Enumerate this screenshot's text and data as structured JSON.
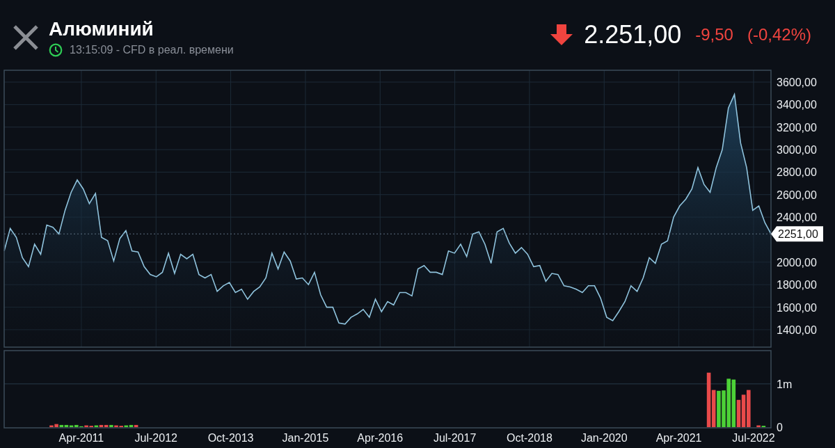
{
  "header": {
    "title": "Алюминий",
    "subtitle": "13:15:09 - CFD в реал. времени",
    "falling": true,
    "price": "2.251,00",
    "change": "-9,50",
    "change_percent": "(-0,42%)"
  },
  "price_chart": {
    "chart_data": {
      "type": "area",
      "ylim": [
        1245,
        3705
      ],
      "yticks": [
        {
          "value": 1400,
          "label": "1400,00"
        },
        {
          "value": 1600,
          "label": "1600,00"
        },
        {
          "value": 1800,
          "label": "1800,00"
        },
        {
          "value": 2000,
          "label": "2000,00"
        },
        {
          "value": 2400,
          "label": "2400,00"
        },
        {
          "value": 2600,
          "label": "2600,00"
        },
        {
          "value": 2800,
          "label": "2800,00"
        },
        {
          "value": 3000,
          "label": "3000,00"
        },
        {
          "value": 3200,
          "label": "3200,00"
        },
        {
          "value": 3400,
          "label": "3400,00"
        },
        {
          "value": 3600,
          "label": "3600,00"
        }
      ],
      "series": [
        {
          "color": "#8fc3dd",
          "values": [
            2100,
            2300,
            2220,
            2040,
            1960,
            2160,
            2070,
            2330,
            2310,
            2250,
            2460,
            2620,
            2730,
            2650,
            2520,
            2610,
            2220,
            2190,
            2010,
            2210,
            2280,
            2100,
            2090,
            1960,
            1890,
            1870,
            1910,
            2080,
            1900,
            2070,
            2030,
            2070,
            1890,
            1860,
            1890,
            1740,
            1790,
            1820,
            1730,
            1760,
            1670,
            1740,
            1780,
            1860,
            2080,
            1940,
            2090,
            2010,
            1850,
            1860,
            1800,
            1910,
            1710,
            1600,
            1600,
            1460,
            1450,
            1510,
            1540,
            1580,
            1510,
            1670,
            1560,
            1650,
            1620,
            1730,
            1730,
            1700,
            1940,
            1970,
            1910,
            1910,
            1890,
            2100,
            2080,
            2160,
            2050,
            2250,
            2270,
            2160,
            1990,
            2270,
            2300,
            2170,
            2080,
            2130,
            2070,
            1960,
            1970,
            1830,
            1900,
            1890,
            1790,
            1780,
            1760,
            1730,
            1790,
            1790,
            1680,
            1510,
            1480,
            1560,
            1650,
            1790,
            1740,
            1860,
            2040,
            1990,
            2160,
            2190,
            2400,
            2500,
            2560,
            2650,
            2840,
            2690,
            2620,
            2840,
            3000,
            3370,
            3490,
            3060,
            2840,
            2460,
            2500,
            2350,
            2251
          ]
        }
      ],
      "ref_lines": [
        {
          "axis": "y",
          "value": 2251,
          "label": "2251,00"
        }
      ],
      "grid": true
    }
  },
  "volume_chart": {
    "chart_data": {
      "type": "bar",
      "grid": true,
      "ylim": [
        0,
        1770000
      ],
      "categories": [
        null,
        null,
        null,
        null,
        null,
        null,
        null,
        null,
        null,
        null,
        null,
        null,
        null,
        null,
        null,
        "Apr-2011",
        null,
        null,
        null,
        null,
        null,
        null,
        null,
        null,
        null,
        null,
        null,
        null,
        null,
        null,
        "Jul-2012",
        null,
        null,
        null,
        null,
        null,
        null,
        null,
        null,
        null,
        null,
        null,
        null,
        null,
        null,
        "Oct-2013",
        null,
        null,
        null,
        null,
        null,
        null,
        null,
        null,
        null,
        null,
        null,
        null,
        null,
        null,
        "Jan-2015",
        null,
        null,
        null,
        null,
        null,
        null,
        null,
        null,
        null,
        null,
        null,
        null,
        null,
        null,
        "Apr-2016",
        null,
        null,
        null,
        null,
        null,
        null,
        null,
        null,
        null,
        null,
        null,
        null,
        null,
        null,
        "Jul-2017",
        null,
        null,
        null,
        null,
        null,
        null,
        null,
        null,
        null,
        null,
        null,
        null,
        null,
        null,
        "Oct-2018",
        null,
        null,
        null,
        null,
        null,
        null,
        null,
        null,
        null,
        null,
        null,
        null,
        null,
        null,
        "Jan-2020",
        null,
        null,
        null,
        null,
        null,
        null,
        null,
        null,
        null,
        null,
        null,
        null,
        null,
        null,
        "Apr-2021",
        null,
        null,
        null,
        null,
        null,
        null,
        null,
        null,
        null,
        null,
        null,
        null,
        null,
        null,
        "Jul-2022",
        null,
        null,
        null
      ],
      "yticks": [
        {
          "value": 0,
          "label": "0"
        },
        {
          "value": 1000000,
          "label": "1m"
        }
      ],
      "series": [
        {
          "color": "#e84a4a",
          "values": [
            null,
            null,
            null,
            null,
            null,
            null,
            null,
            null,
            null,
            40000,
            70000,
            null,
            null,
            null,
            null,
            null,
            40000,
            30000,
            null,
            50000,
            50000,
            null,
            40000,
            30000,
            null,
            null,
            50000,
            null,
            null,
            null,
            null,
            null,
            null,
            null,
            null,
            null,
            null,
            null,
            null,
            null,
            null,
            null,
            null,
            null,
            null,
            null,
            null,
            null,
            null,
            null,
            null,
            null,
            null,
            null,
            null,
            null,
            null,
            null,
            null,
            null,
            null,
            null,
            null,
            null,
            null,
            null,
            null,
            null,
            null,
            null,
            null,
            null,
            null,
            null,
            null,
            null,
            null,
            null,
            null,
            null,
            null,
            null,
            null,
            null,
            null,
            null,
            null,
            null,
            null,
            null,
            null,
            null,
            null,
            null,
            null,
            null,
            null,
            null,
            null,
            null,
            null,
            null,
            null,
            null,
            null,
            null,
            null,
            null,
            null,
            null,
            null,
            null,
            null,
            null,
            null,
            null,
            null,
            null,
            null,
            null,
            null,
            null,
            null,
            null,
            null,
            null,
            null,
            null,
            null,
            null,
            null,
            null,
            null,
            null,
            null,
            null,
            null,
            null,
            null,
            null,
            null,
            1260000,
            860000,
            null,
            null,
            null,
            null,
            630000,
            750000,
            860000,
            null,
            40000,
            null,
            null
          ]
        },
        {
          "color": "#4cd137",
          "values": [
            null,
            null,
            null,
            null,
            null,
            null,
            null,
            null,
            null,
            null,
            null,
            50000,
            50000,
            40000,
            50000,
            20000,
            null,
            null,
            40000,
            null,
            null,
            50000,
            null,
            null,
            40000,
            50000,
            null,
            null,
            null,
            null,
            null,
            null,
            null,
            null,
            null,
            null,
            null,
            null,
            null,
            null,
            null,
            null,
            null,
            null,
            null,
            null,
            null,
            null,
            null,
            null,
            null,
            null,
            null,
            null,
            null,
            null,
            null,
            null,
            null,
            null,
            null,
            null,
            null,
            null,
            null,
            null,
            null,
            null,
            null,
            null,
            null,
            null,
            null,
            null,
            null,
            null,
            null,
            null,
            null,
            null,
            null,
            null,
            null,
            null,
            null,
            null,
            null,
            null,
            null,
            null,
            null,
            null,
            null,
            null,
            null,
            null,
            null,
            null,
            null,
            null,
            null,
            null,
            null,
            null,
            null,
            null,
            null,
            null,
            null,
            null,
            null,
            null,
            null,
            null,
            null,
            null,
            null,
            null,
            null,
            null,
            null,
            null,
            null,
            null,
            null,
            null,
            null,
            null,
            null,
            null,
            null,
            null,
            null,
            null,
            null,
            null,
            null,
            null,
            null,
            null,
            null,
            null,
            null,
            840000,
            850000,
            1120000,
            1100000,
            null,
            null,
            null,
            null,
            null,
            30000,
            null
          ]
        }
      ]
    }
  }
}
